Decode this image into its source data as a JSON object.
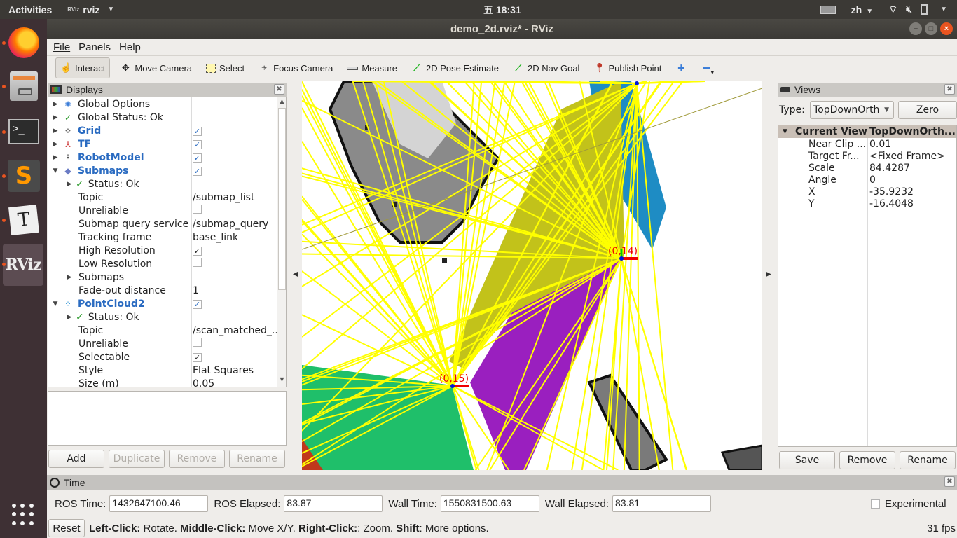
{
  "topbar": {
    "activities": "Activities",
    "app_name": "rviz",
    "app_logo": "RViz",
    "clock": "五 18:31",
    "language": "zh"
  },
  "dock": {
    "items": [
      {
        "name": "firefox"
      },
      {
        "name": "files"
      },
      {
        "name": "terminal",
        "glyph": ">_"
      },
      {
        "name": "sublime-text",
        "glyph": "S"
      },
      {
        "name": "typora",
        "glyph": "T"
      },
      {
        "name": "rviz",
        "glyph": "RViz"
      }
    ]
  },
  "window": {
    "title": "demo_2d.rviz* - RViz"
  },
  "menu": {
    "file": "File",
    "panels": "Panels",
    "help": "Help"
  },
  "toolbar": {
    "tools": [
      {
        "label": "Interact",
        "icon": "hand-icon",
        "active": true
      },
      {
        "label": "Move Camera",
        "icon": "move-camera-icon"
      },
      {
        "label": "Select",
        "icon": "select-icon"
      },
      {
        "label": "Focus Camera",
        "icon": "focus-camera-icon"
      },
      {
        "label": "Measure",
        "icon": "ruler-icon"
      },
      {
        "label": "2D Pose Estimate",
        "icon": "green-arrow-icon"
      },
      {
        "label": "2D Nav Goal",
        "icon": "green-arrow-icon"
      },
      {
        "label": "Publish Point",
        "icon": "map-pin-icon"
      }
    ]
  },
  "displays": {
    "title": "Displays",
    "rows": [
      {
        "label": "Global Options",
        "value": ""
      },
      {
        "label": "Global Status: Ok",
        "value": ""
      },
      {
        "label": "Grid",
        "checked": true
      },
      {
        "label": "TF",
        "checked": true
      },
      {
        "label": "RobotModel",
        "checked": true
      },
      {
        "label": "Submaps",
        "checked": true
      },
      {
        "label": "Status: Ok",
        "value": ""
      },
      {
        "label": "Topic",
        "value": "/submap_list"
      },
      {
        "label": "Unreliable",
        "checked": false
      },
      {
        "label": "Submap query service",
        "value": "/submap_query"
      },
      {
        "label": "Tracking frame",
        "value": "base_link"
      },
      {
        "label": "High Resolution",
        "checked": true
      },
      {
        "label": "Low Resolution",
        "checked": false
      },
      {
        "label": "Submaps",
        "value": ""
      },
      {
        "label": "Fade-out distance",
        "value": "1"
      },
      {
        "label": "PointCloud2",
        "checked": true
      },
      {
        "label": "Status: Ok",
        "value": ""
      },
      {
        "label": "Topic",
        "value": "/scan_matched_..."
      },
      {
        "label": "Unreliable",
        "checked": false
      },
      {
        "label": "Selectable",
        "checked": true
      },
      {
        "label": "Style",
        "value": "Flat Squares"
      },
      {
        "label": "Size (m)",
        "value": "0.05"
      }
    ],
    "buttons": {
      "add": "Add",
      "duplicate": "Duplicate",
      "remove": "Remove",
      "rename": "Rename"
    }
  },
  "viewport": {
    "labels": [
      {
        "text": "(0,14)"
      },
      {
        "text": "(0,15)"
      }
    ],
    "colors": {
      "yellow": "#ffff00",
      "olive": "#c2c21a",
      "purple": "#9a1fbf",
      "green": "#1fbf6a",
      "blue": "#1e8cc4",
      "red": "#c0381c"
    }
  },
  "views": {
    "title": "Views",
    "type_label": "Type:",
    "type_value": "TopDownOrth",
    "zero": "Zero",
    "current_view": {
      "key": "Current View",
      "value": "TopDownOrth..."
    },
    "props": [
      {
        "key": "Near Clip ...",
        "value": "0.01"
      },
      {
        "key": "Target Fr...",
        "value": "<Fixed Frame>"
      },
      {
        "key": "Scale",
        "value": "84.4287"
      },
      {
        "key": "Angle",
        "value": "0"
      },
      {
        "key": "X",
        "value": "-35.9232"
      },
      {
        "key": "Y",
        "value": "-16.4048"
      }
    ],
    "buttons": {
      "save": "Save",
      "remove": "Remove",
      "rename": "Rename"
    }
  },
  "time": {
    "title": "Time",
    "ros_time_label": "ROS Time:",
    "ros_time": "1432647100.46",
    "ros_elapsed_label": "ROS Elapsed:",
    "ros_elapsed": "83.87",
    "wall_time_label": "Wall Time:",
    "wall_time": "1550831500.63",
    "wall_elapsed_label": "Wall Elapsed:",
    "wall_elapsed": "83.81",
    "experimental": "Experimental"
  },
  "status": {
    "reset": "Reset",
    "left_click": "Left-Click:",
    "left_click_desc": " Rotate. ",
    "middle_click": "Middle-Click:",
    "middle_click_desc": " Move X/Y. ",
    "right_click": "Right-Click:",
    "right_click_desc": ": Zoom. ",
    "shift": "Shift",
    "shift_desc": ": More options.",
    "fps": "31 fps"
  }
}
